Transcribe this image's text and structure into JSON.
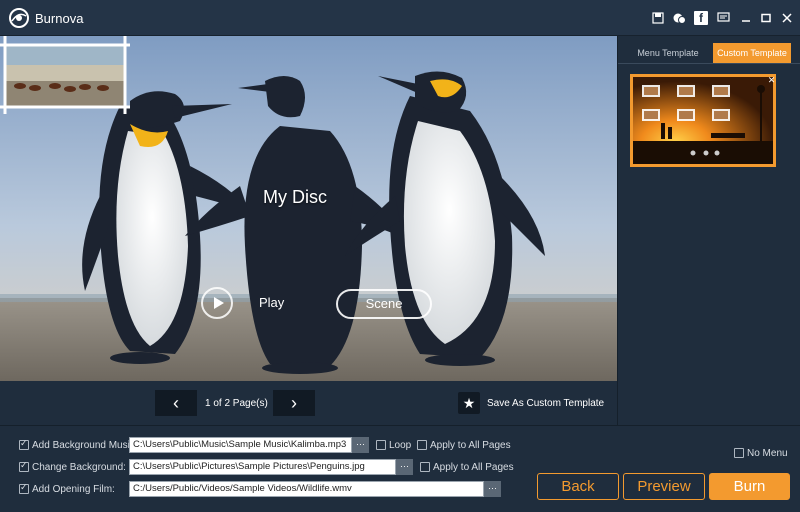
{
  "app": {
    "title": "Burnova"
  },
  "titlebar": {
    "icons": [
      "save-icon",
      "feedback-icon",
      "facebook-icon",
      "message-icon",
      "minimize-icon",
      "maximize-icon",
      "close-icon"
    ],
    "facebook_glyph": "f"
  },
  "preview": {
    "disc_title": "My Disc",
    "play_label": "Play",
    "scene_label": "Scene"
  },
  "pager": {
    "page_text": "1 of 2 Page(s)",
    "save_template_label": "Save As Custom Template"
  },
  "tabs": {
    "menu_template": "Menu Template",
    "custom_template": "Custom Template",
    "active": "custom_template"
  },
  "options": {
    "background_music": {
      "label": "Add Background Music:",
      "checked": true,
      "value": "C:\\Users\\Public\\Music\\Sample Music\\Kalimba.mp3",
      "loop_label": "Loop",
      "loop_checked": false,
      "apply_label": "Apply to All Pages",
      "apply_checked": false
    },
    "change_background": {
      "label": "Change Background:",
      "checked": true,
      "value": "C:\\Users\\Public\\Pictures\\Sample Pictures\\Penguins.jpg",
      "apply_label": "Apply to All Pages",
      "apply_checked": false
    },
    "opening_film": {
      "label": "Add Opening Film:",
      "checked": true,
      "value": "C:/Users/Public/Videos/Sample Videos/Wildlife.wmv"
    },
    "browse_label": "···",
    "no_menu_label": "No Menu",
    "no_menu_checked": false
  },
  "actions": {
    "back": "Back",
    "preview": "Preview",
    "burn": "Burn"
  },
  "colors": {
    "accent": "#f39a2f",
    "background": "#1f2d3d",
    "titlebar": "#243447"
  }
}
